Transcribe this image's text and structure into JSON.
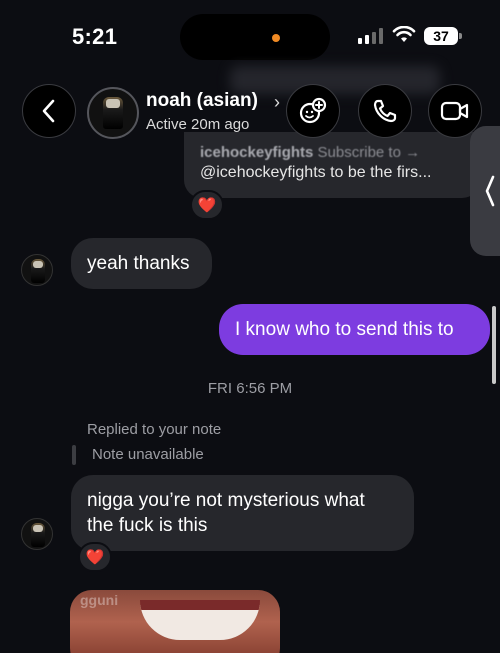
{
  "status_bar": {
    "time": "5:21",
    "battery": "37"
  },
  "header": {
    "contact_name": "noah (asian)",
    "chevron": "›",
    "activity": "Active 20m ago",
    "icons": [
      "back-chevron-icon",
      "effects-icon",
      "phone-icon",
      "video-camera-icon"
    ]
  },
  "shared_post": {
    "source": "icehockeyfights",
    "blurred_text": "Subscribe to →",
    "text": "@icehockeyfights to be the firs...",
    "reaction": "❤️"
  },
  "messages": [
    {
      "from": "them",
      "text": "yeah thanks"
    },
    {
      "from": "me",
      "text": "I know who to send this to"
    }
  ],
  "date_separator": "FRI 6:56 PM",
  "reply": {
    "label": "Replied to your note",
    "quoted": "Note unavailable",
    "text_line1": "nigga you’re not mysterious what",
    "text_line2": "the fuck is this",
    "reaction": "❤️"
  },
  "photo_watermark": "gguni",
  "colors": {
    "background": "#0c0d12",
    "incoming_bubble": "#26272c",
    "outgoing_bubble": "#7d3ce0",
    "reaction_heart": "#e0245e"
  }
}
